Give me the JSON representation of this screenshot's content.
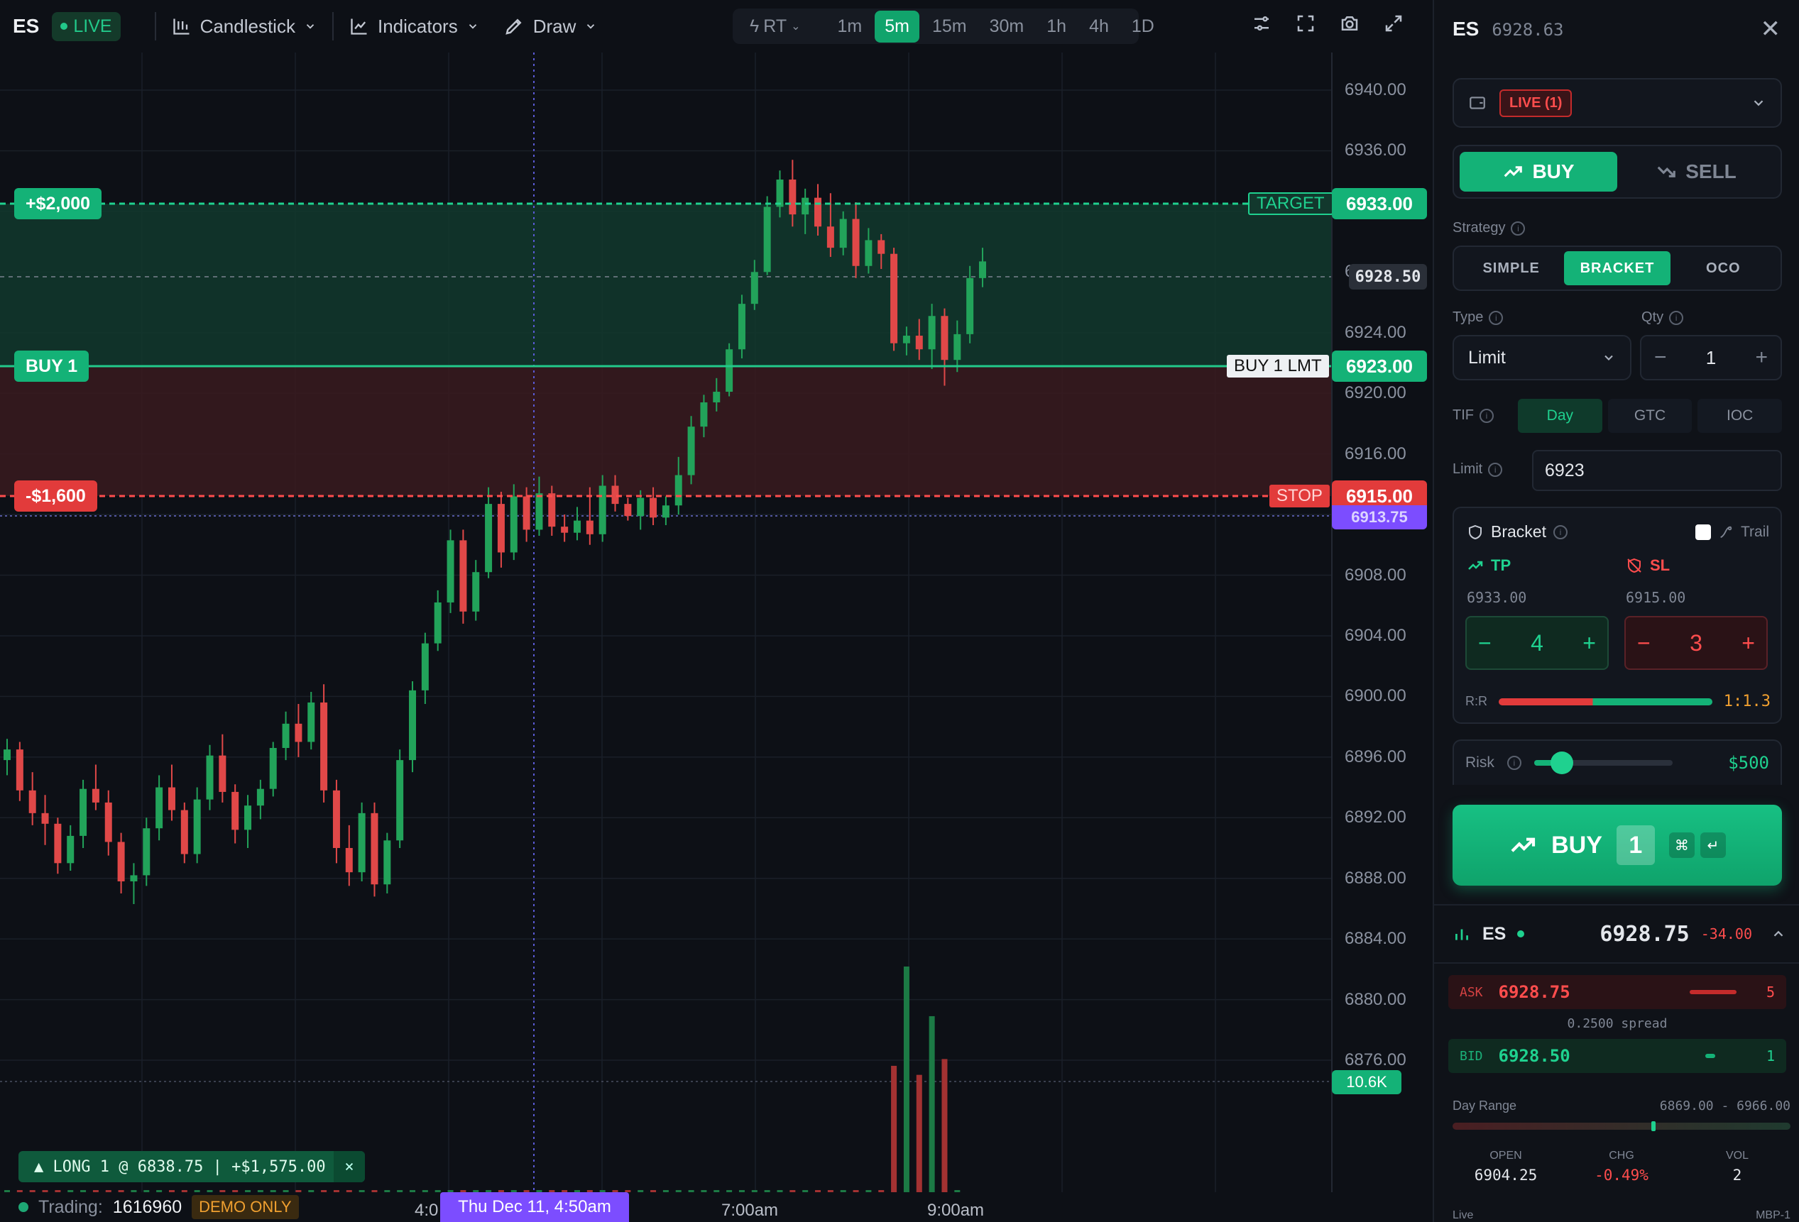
{
  "toolbar": {
    "symbol": "ES",
    "live_label": "LIVE",
    "chart_type": "Candlestick",
    "indicators": "Indicators",
    "draw": "Draw",
    "rt": "RT",
    "timeframes": [
      "1m",
      "5m",
      "15m",
      "30m",
      "1h",
      "4h",
      "1D"
    ],
    "active_timeframe": "5m"
  },
  "chart": {
    "price_axis": [
      "6940.00",
      "6936.00",
      "6932.00",
      "6928.00",
      "6924.00",
      "6920.00",
      "6916.00",
      "6912.00",
      "6908.00",
      "6904.00",
      "6900.00",
      "6896.00",
      "6892.00",
      "6888.00",
      "6884.00",
      "6880.00",
      "6876.00"
    ],
    "target": {
      "badge": "+$2,000",
      "label": "TARGET",
      "price": "6933.00"
    },
    "entry": {
      "badge": "BUY 1",
      "label": "BUY 1 LMT",
      "price": "6923.00"
    },
    "stop": {
      "badge": "-$1,600",
      "label": "STOP",
      "price": "6915.00"
    },
    "last_price": "6928.50",
    "stop_sub_price": "6913.75",
    "volume_tag": "10.6K",
    "time_labels": [
      "4:0",
      "Thu Dec 11, 4:50am",
      "7:00am",
      "9:00am"
    ],
    "position": "▲ LONG 1 @ 6838.75 | +$1,575.00",
    "position_close": "×",
    "trading_label": "Trading:",
    "account": "1616960",
    "demo": "DEMO ONLY",
    "colors": {
      "up": "#22a35a",
      "down": "#e04848",
      "target": "#1fd18f",
      "stop": "#ff4d4d",
      "entry": "#22c98a"
    }
  },
  "chart_data": {
    "type": "candlestick",
    "ylim": [
      6874,
      6944
    ],
    "ohlc": [
      [
        6895.8,
        6897.2,
        6894.8,
        6896.5
      ],
      [
        6896.5,
        6897.0,
        6893.1,
        6893.8
      ],
      [
        6893.8,
        6895.0,
        6891.5,
        6892.3
      ],
      [
        6892.3,
        6893.5,
        6890.2,
        6891.6
      ],
      [
        6891.6,
        6892.0,
        6888.3,
        6889.0
      ],
      [
        6889.0,
        6891.5,
        6888.5,
        6890.8
      ],
      [
        6890.8,
        6894.5,
        6890.0,
        6893.9
      ],
      [
        6893.9,
        6895.5,
        6892.5,
        6893.0
      ],
      [
        6893.0,
        6893.8,
        6889.5,
        6890.4
      ],
      [
        6890.4,
        6891.0,
        6887.0,
        6887.8
      ],
      [
        6887.8,
        6889.0,
        6886.3,
        6888.2
      ],
      [
        6888.2,
        6892.0,
        6887.5,
        6891.3
      ],
      [
        6891.3,
        6894.8,
        6890.5,
        6894.0
      ],
      [
        6894.0,
        6895.5,
        6891.8,
        6892.5
      ],
      [
        6892.5,
        6893.0,
        6889.0,
        6889.6
      ],
      [
        6889.6,
        6894.0,
        6889.0,
        6893.2
      ],
      [
        6893.2,
        6896.8,
        6892.5,
        6896.1
      ],
      [
        6896.1,
        6897.5,
        6893.0,
        6893.7
      ],
      [
        6893.7,
        6894.2,
        6890.3,
        6891.2
      ],
      [
        6891.2,
        6893.5,
        6890.0,
        6892.8
      ],
      [
        6892.8,
        6894.5,
        6891.9,
        6893.9
      ],
      [
        6893.9,
        6897.0,
        6893.4,
        6896.6
      ],
      [
        6896.6,
        6899.0,
        6895.8,
        6898.2
      ],
      [
        6898.2,
        6899.5,
        6896.0,
        6897.0
      ],
      [
        6897.0,
        6900.3,
        6896.5,
        6899.6
      ],
      [
        6899.6,
        6900.8,
        6893.0,
        6893.8
      ],
      [
        6893.8,
        6894.5,
        6889.0,
        6890.0
      ],
      [
        6890.0,
        6891.5,
        6887.5,
        6888.4
      ],
      [
        6888.4,
        6893.0,
        6887.8,
        6892.3
      ],
      [
        6892.3,
        6893.0,
        6886.8,
        6887.6
      ],
      [
        6887.6,
        6891.0,
        6887.0,
        6890.5
      ],
      [
        6890.5,
        6896.5,
        6890.0,
        6895.8
      ],
      [
        6895.8,
        6901.0,
        6895.0,
        6900.4
      ],
      [
        6900.4,
        6904.2,
        6899.5,
        6903.5
      ],
      [
        6903.5,
        6907.0,
        6903.0,
        6906.2
      ],
      [
        6906.2,
        6911.0,
        6905.5,
        6910.3
      ],
      [
        6910.3,
        6911.0,
        6904.8,
        6905.6
      ],
      [
        6905.6,
        6909.0,
        6905.0,
        6908.2
      ],
      [
        6908.2,
        6913.8,
        6907.8,
        6912.7
      ],
      [
        6912.7,
        6913.5,
        6908.5,
        6909.5
      ],
      [
        6909.5,
        6914.0,
        6909.0,
        6913.2
      ],
      [
        6913.2,
        6913.8,
        6910.2,
        6911.0
      ],
      [
        6911.0,
        6914.5,
        6910.6,
        6913.4
      ],
      [
        6913.4,
        6913.9,
        6910.6,
        6911.2
      ],
      [
        6911.2,
        6912.0,
        6910.2,
        6910.8
      ],
      [
        6910.8,
        6912.5,
        6910.3,
        6911.6
      ],
      [
        6911.6,
        6913.8,
        6910.0,
        6910.7
      ],
      [
        6910.7,
        6914.6,
        6910.2,
        6913.9
      ],
      [
        6913.9,
        6914.6,
        6912.2,
        6912.7
      ],
      [
        6912.7,
        6913.1,
        6911.6,
        6911.9
      ],
      [
        6911.9,
        6913.6,
        6911.0,
        6913.1
      ],
      [
        6913.1,
        6913.8,
        6911.3,
        6911.8
      ],
      [
        6911.8,
        6913.2,
        6911.3,
        6912.6
      ],
      [
        6912.6,
        6915.8,
        6912.0,
        6914.6
      ],
      [
        6914.6,
        6918.5,
        6914.0,
        6917.8
      ],
      [
        6917.8,
        6919.9,
        6917.1,
        6919.4
      ],
      [
        6919.4,
        6921.0,
        6918.8,
        6920.1
      ],
      [
        6920.1,
        6923.3,
        6919.8,
        6922.9
      ],
      [
        6922.9,
        6926.5,
        6922.3,
        6925.9
      ],
      [
        6925.9,
        6928.8,
        6925.5,
        6928.0
      ],
      [
        6928.0,
        6933.0,
        6927.8,
        6932.3
      ],
      [
        6932.3,
        6934.7,
        6931.6,
        6934.1
      ],
      [
        6934.1,
        6935.4,
        6931.0,
        6931.8
      ],
      [
        6931.8,
        6933.5,
        6930.5,
        6932.9
      ],
      [
        6932.9,
        6933.8,
        6930.4,
        6931.0
      ],
      [
        6931.0,
        6933.2,
        6929.0,
        6929.6
      ],
      [
        6929.6,
        6932.0,
        6929.1,
        6931.5
      ],
      [
        6931.5,
        6932.6,
        6927.6,
        6928.4
      ],
      [
        6928.4,
        6930.9,
        6927.9,
        6930.1
      ],
      [
        6930.1,
        6930.5,
        6928.2,
        6929.2
      ],
      [
        6929.2,
        6929.6,
        6922.8,
        6923.3
      ],
      [
        6923.3,
        6924.4,
        6922.5,
        6923.8
      ],
      [
        6923.8,
        6924.9,
        6922.2,
        6922.9
      ],
      [
        6922.9,
        6925.9,
        6921.6,
        6925.1
      ],
      [
        6925.1,
        6925.6,
        6920.5,
        6922.2
      ],
      [
        6922.2,
        6924.8,
        6921.4,
        6923.9
      ],
      [
        6923.9,
        6928.4,
        6923.3,
        6927.6
      ],
      [
        6927.6,
        6929.6,
        6927.0,
        6928.7
      ]
    ],
    "volume_label": "10.6K"
  },
  "panel": {
    "symbol": "ES",
    "price": "6928.63",
    "close": "✕",
    "account_tag": "LIVE (1)",
    "buy": "BUY",
    "sell": "SELL",
    "strategy_label": "Strategy",
    "strategies": [
      "SIMPLE",
      "BRACKET",
      "OCO"
    ],
    "active_strategy": "BRACKET",
    "type_label": "Type",
    "type_value": "Limit",
    "qty_label": "Qty",
    "qty_value": "1",
    "tif_label": "TIF",
    "tifs": [
      "Day",
      "GTC",
      "IOC"
    ],
    "active_tif": "Day",
    "limit_label": "Limit",
    "limit_value": "6923",
    "bracket_label": "Bracket",
    "trail_label": "Trail",
    "tp_label": "TP",
    "tp_price": "6933.00",
    "tp_ticks": "4",
    "sl_label": "SL",
    "sl_price": "6915.00",
    "sl_ticks": "3",
    "rr_label": "R:R",
    "rr_value": "1:1.3",
    "risk_label": "Risk",
    "risk_value": "$500",
    "big_buy_label": "BUY",
    "big_buy_qty": "1",
    "key1": "⌘",
    "key2": "↵"
  },
  "quote": {
    "symbol": "ES",
    "last": "6928.75",
    "change": "-34.00",
    "ask_label": "ASK",
    "ask": "6928.75",
    "ask_size": "5",
    "spread": "0.2500 spread",
    "bid_label": "BID",
    "bid": "6928.50",
    "bid_size": "1",
    "day_range_label": "Day Range",
    "day_range": "6869.00 - 6966.00",
    "open_label": "OPEN",
    "open": "6904.25",
    "chg_label": "CHG",
    "chg": "-0.49%",
    "vol_label": "VOL",
    "vol": "2",
    "foot_left": "Live",
    "foot_right": "MBP-1"
  }
}
